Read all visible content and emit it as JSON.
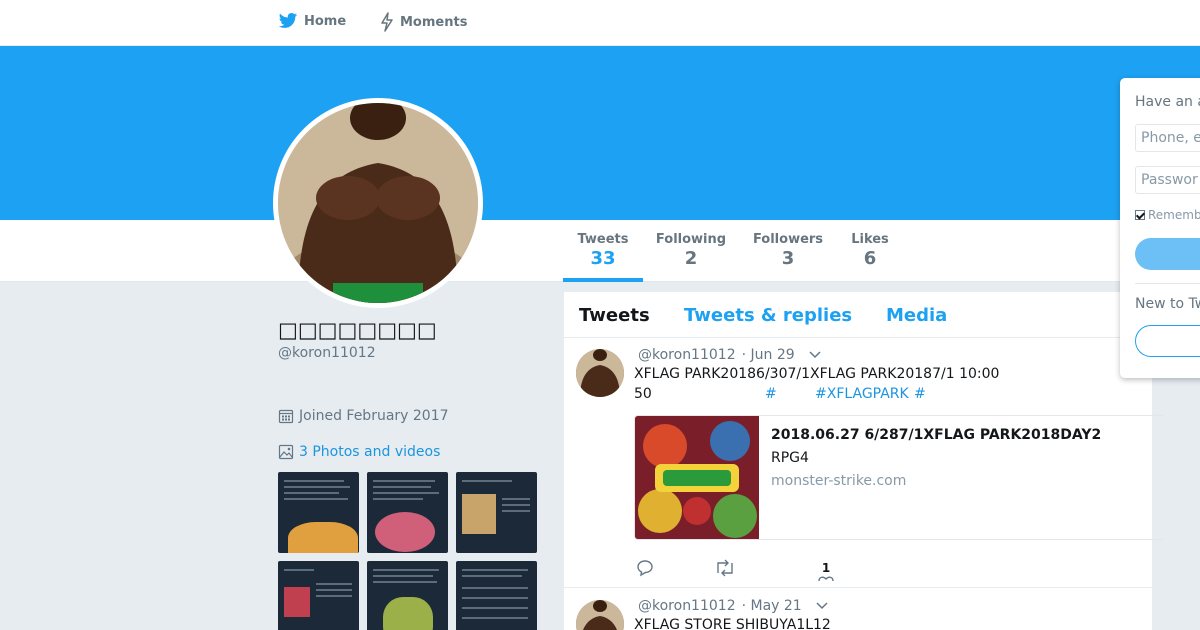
{
  "nav": {
    "home_label": "Home",
    "moments_label": "Moments"
  },
  "colors": {
    "accent": "#1da1f2",
    "banner": "#1da1f2",
    "link": "#1b95e0"
  },
  "profile": {
    "name": "□□□□□□□□",
    "handle": "@koron11012",
    "joined": "Joined February 2017",
    "photos_link": "3 Photos and videos"
  },
  "stats": [
    {
      "label": "Tweets",
      "value": "33"
    },
    {
      "label": "Following",
      "value": "2"
    },
    {
      "label": "Followers",
      "value": "3"
    },
    {
      "label": "Likes",
      "value": "6"
    }
  ],
  "tabs": {
    "tweets": "Tweets",
    "replies": "Tweets & replies",
    "media": "Media"
  },
  "tweets": [
    {
      "handle": "@koron11012",
      "date": "· Jun 29",
      "line1": "XFLAG PARK20186/307/1XFLAG PARK20187/1 10:00",
      "line2_pre": "50",
      "hash1": "#",
      "hash2": "#XFLAGPARK",
      "hash3": "#",
      "card": {
        "title": "2018.06.27 6/287/1XFLAG PARK2018DAY2",
        "desc": "RPG4",
        "url": "monster-strike.com"
      },
      "like_count": "1"
    },
    {
      "handle": "@koron11012",
      "date": "· May 21",
      "line1": "XFLAG STORE SHIBUYA1L12"
    }
  ],
  "login": {
    "question": "Have an a",
    "phone_placeholder": "Phone, e",
    "password_placeholder": "Passwor",
    "remember": "Rememb",
    "new_to": "New to Tw"
  }
}
